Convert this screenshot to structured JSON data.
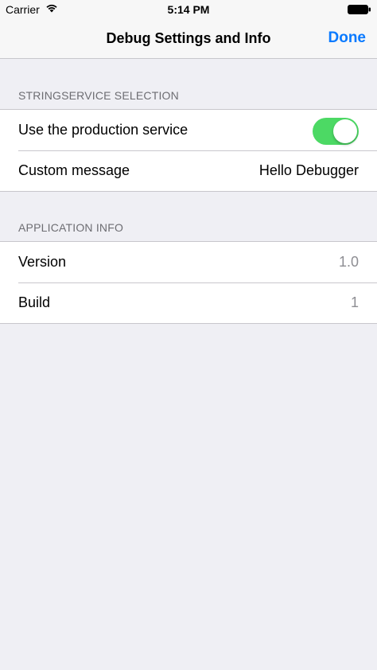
{
  "status_bar": {
    "carrier": "Carrier",
    "time": "5:14 PM",
    "wifi_icon": "wifi-icon",
    "battery_icon": "battery-icon"
  },
  "nav": {
    "title": "Debug Settings and Info",
    "done_label": "Done",
    "accent_color": "#0a7aff"
  },
  "sections": [
    {
      "header": "STRINGSERVICE SELECTION",
      "rows": [
        {
          "label": "Use the production service",
          "toggle_on": true,
          "toggle_color": "#4cd964"
        },
        {
          "label": "Custom message",
          "value": "Hello Debugger"
        }
      ]
    },
    {
      "header": "APPLICATION INFO",
      "rows": [
        {
          "label": "Version",
          "value": "1.0"
        },
        {
          "label": "Build",
          "value": "1"
        }
      ]
    }
  ]
}
